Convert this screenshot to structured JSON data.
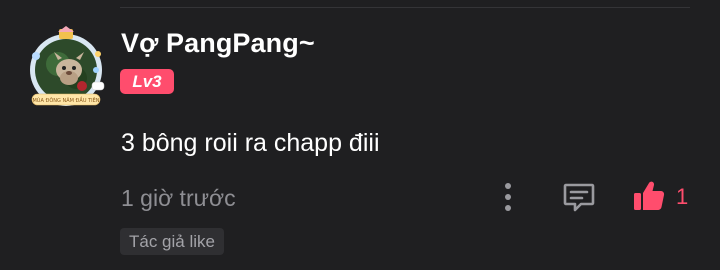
{
  "comment": {
    "username": "Vợ PangPang~",
    "level": "Lv3",
    "text": "3 bông roii ra chapp điii",
    "timestamp": "1 giờ trước",
    "like_count": "1",
    "author_tag": "Tác giả like",
    "avatar_frame_caption": "MÙA ĐÔNG NĂM ĐẦU TIÊN"
  },
  "icons": {
    "more": "more-vertical-icon",
    "reply": "comment-bubble-icon",
    "like": "thumbs-up-icon"
  },
  "colors": {
    "background": "#1f1f21",
    "accent": "#ff4d6d",
    "muted_text": "#8e8e93",
    "tag_background": "#2f2f32"
  }
}
